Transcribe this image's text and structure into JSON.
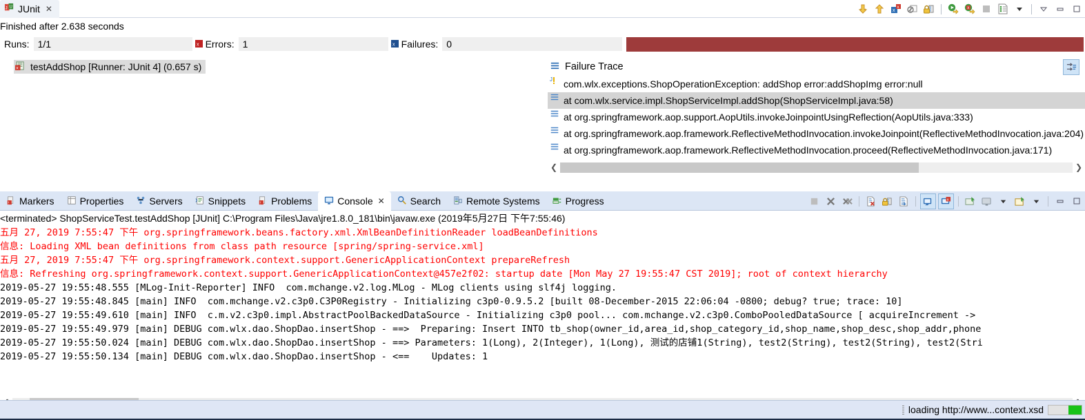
{
  "junit": {
    "tab_label": "JUnit",
    "tab_close": "✕",
    "status_line": "Finished after 2.638 seconds",
    "counters": {
      "runs_label": "Runs:",
      "runs_value": "1/1",
      "errors_label": "Errors:",
      "errors_value": "1",
      "failures_label": "Failures:",
      "failures_value": "0",
      "progress_color": "#9e3b3b"
    },
    "tree": {
      "item_label": "testAddShop [Runner: JUnit 4] (0.657 s)"
    },
    "failure_trace": {
      "title": "Failure Trace",
      "rows": [
        {
          "text": "com.wlx.exceptions.ShopOperationException: addShop error:addShopImg error:null",
          "icon": "exception-icon",
          "selected": false
        },
        {
          "text": "at com.wlx.service.impl.ShopServiceImpl.addShop(ShopServiceImpl.java:58)",
          "icon": "stackframe-icon",
          "selected": true
        },
        {
          "text": "at org.springframework.aop.support.AopUtils.invokeJoinpointUsingReflection(AopUtils.java:333)",
          "icon": "stackframe-icon",
          "selected": false
        },
        {
          "text": "at org.springframework.aop.framework.ReflectiveMethodInvocation.invokeJoinpoint(ReflectiveMethodInvocation.java:204)",
          "icon": "stackframe-icon",
          "selected": false
        },
        {
          "text": "at org.springframework.aop.framework.ReflectiveMethodInvocation.proceed(ReflectiveMethodInvocation.java:171)",
          "icon": "stackframe-icon",
          "selected": false
        }
      ],
      "scroll_left": "❮",
      "scroll_right": "❯"
    },
    "toolbar_icons": [
      "next-failure-icon",
      "previous-failure-icon",
      "show-failures-only-icon",
      "stop-on-error-icon",
      "lock-scroll-icon",
      "rerun-test-icon",
      "rerun-failed-tests-icon",
      "terminate-icon",
      "test-history-icon",
      "history-dropdown-icon",
      "minimize-icon",
      "maximize-icon",
      "view-menu-icon"
    ]
  },
  "console": {
    "tabs": [
      {
        "label": "Markers",
        "icon": "markers-icon",
        "active": false
      },
      {
        "label": "Properties",
        "icon": "properties-icon",
        "active": false
      },
      {
        "label": "Servers",
        "icon": "servers-icon",
        "active": false
      },
      {
        "label": "Snippets",
        "icon": "snippets-icon",
        "active": false
      },
      {
        "label": "Problems",
        "icon": "problems-icon",
        "active": false
      },
      {
        "label": "Console",
        "icon": "console-icon",
        "active": true,
        "close": "✕"
      },
      {
        "label": "Search",
        "icon": "search-icon",
        "active": false
      },
      {
        "label": "Remote Systems",
        "icon": "remote-systems-icon",
        "active": false
      },
      {
        "label": "Progress",
        "icon": "progress-icon",
        "active": false
      }
    ],
    "toolbar_icons": [
      "terminate-icon",
      "remove-launch-icon",
      "remove-all-terminated-icon",
      "clear-console-icon",
      "scroll-lock-icon",
      "word-wrap-icon",
      "show-console-on-output-icon",
      "show-console-on-error-icon",
      "pin-console-icon",
      "display-selected-console-icon",
      "display-dropdown-icon",
      "open-console-icon",
      "open-console-dropdown-icon",
      "minimize-icon",
      "maximize-icon"
    ],
    "lines": [
      {
        "kind": "sys",
        "text": "<terminated> ShopServiceTest.testAddShop [JUnit] C:\\Program Files\\Java\\jre1.8.0_181\\bin\\javaw.exe (2019年5月27日 下午7:55:46)"
      },
      {
        "kind": "err",
        "text": "五月 27, 2019 7:55:47 下午 org.springframework.beans.factory.xml.XmlBeanDefinitionReader loadBeanDefinitions"
      },
      {
        "kind": "err",
        "text": "信息: Loading XML bean definitions from class path resource [spring/spring-service.xml]"
      },
      {
        "kind": "err",
        "text": "五月 27, 2019 7:55:47 下午 org.springframework.context.support.GenericApplicationContext prepareRefresh"
      },
      {
        "kind": "err",
        "text": "信息: Refreshing org.springframework.context.support.GenericApplicationContext@457e2f02: startup date [Mon May 27 19:55:47 CST 2019]; root of context hierarchy"
      },
      {
        "kind": "blk",
        "text": "2019-05-27 19:55:48.555 [MLog-Init-Reporter] INFO  com.mchange.v2.log.MLog - MLog clients using slf4j logging."
      },
      {
        "kind": "blk",
        "text": "2019-05-27 19:55:48.845 [main] INFO  com.mchange.v2.c3p0.C3P0Registry - Initializing c3p0-0.9.5.2 [built 08-December-2015 22:06:04 -0800; debug? true; trace: 10]"
      },
      {
        "kind": "blk",
        "text": "2019-05-27 19:55:49.610 [main] INFO  c.m.v2.c3p0.impl.AbstractPoolBackedDataSource - Initializing c3p0 pool... com.mchange.v2.c3p0.ComboPooledDataSource [ acquireIncrement ->"
      },
      {
        "kind": "blk",
        "text": "2019-05-27 19:55:49.979 [main] DEBUG com.wlx.dao.ShopDao.insertShop - ==>  Preparing: Insert INTO tb_shop(owner_id,area_id,shop_category_id,shop_name,shop_desc,shop_addr,phone"
      },
      {
        "kind": "blk",
        "text": "2019-05-27 19:55:50.024 [main] DEBUG com.wlx.dao.ShopDao.insertShop - ==> Parameters: 1(Long), 2(Integer), 1(Long), 测试的店铺1(String), test2(String), test2(String), test2(Stri"
      },
      {
        "kind": "blk",
        "text": "2019-05-27 19:55:50.134 [main] DEBUG com.wlx.dao.ShopDao.insertShop - <==    Updates: 1"
      }
    ],
    "scroll_left": "❮",
    "scroll_right": "❯"
  },
  "statusbar": {
    "text": "loading http://www...context.xsd",
    "progress_color": "#19c219"
  }
}
